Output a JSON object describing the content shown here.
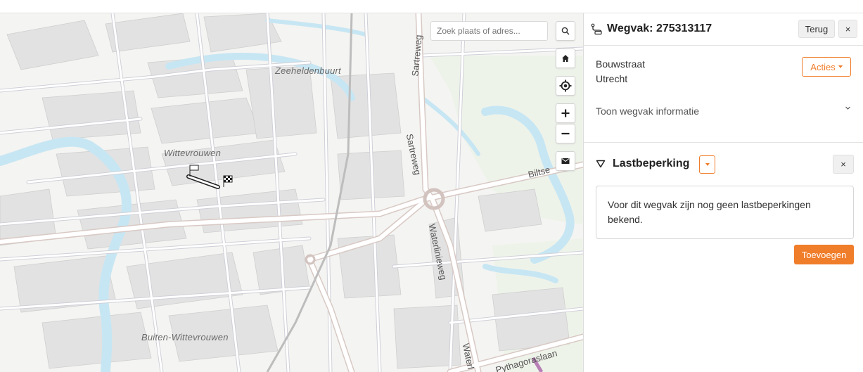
{
  "map": {
    "search": {
      "placeholder": "Zoek plaats of adres..."
    },
    "labels": {
      "zeeheldenbuurt": "Zeeheldenbuurt",
      "wittevrouwen": "Wittevrouwen",
      "buiten_wittevrouwen": "Buiten-Wittevrouwen",
      "sartreweg_1": "Sartreweg",
      "sartreweg_2": "Sartreweg",
      "waterlinieweg_1": "Waterlinieweg",
      "waterlinieweg_2": "Waterl",
      "biltsestraatweg": "Biltse",
      "pythagoraslaan": "Pythagoraslaan"
    },
    "controls": [
      "search-icon",
      "home-icon",
      "locate-icon",
      "zoom-in-icon",
      "zoom-out-icon",
      "mail-icon"
    ],
    "colors": {
      "water": "#c7e6f3",
      "road": "#ffffff",
      "road_casing": "#cfcfd6",
      "block": "#e4e4e4",
      "green": "#eef3ea",
      "route": "#b87fb6"
    }
  },
  "panel": {
    "title": "Wegvak: 275313117",
    "back_label": "Terug",
    "close_label": "×",
    "address": {
      "street": "Bouwstraat",
      "city": "Utrecht"
    },
    "actions_label": "Acties",
    "info_toggle_label": "Toon wegvak informatie",
    "section": {
      "title": "Lastbeperking",
      "close_label": "×",
      "message": "Voor dit wegvak zijn nog geen lastbeperkingen bekend.",
      "add_label": "Toevoegen"
    },
    "colors": {
      "accent": "#f07d2a"
    }
  }
}
